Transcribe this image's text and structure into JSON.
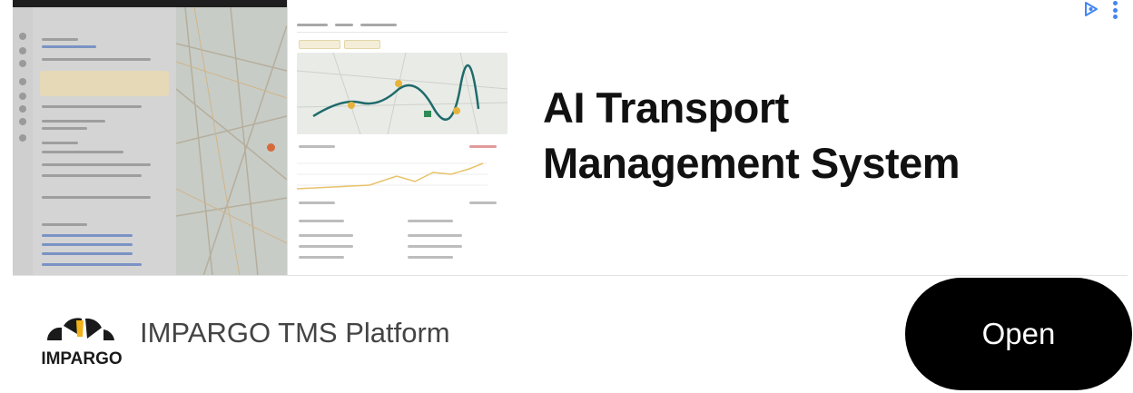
{
  "ad": {
    "headline": [
      "AI Transport",
      "Management System"
    ],
    "advertiser": "IMPARGO TMS Platform",
    "logo_text": "IMPARGO",
    "cta_label": "Open",
    "colors": {
      "cta_background": "#000000",
      "cta_text": "#ffffff",
      "headline": "#111111",
      "adchoices": "#4285f4",
      "logo_dark": "#1a1a1a",
      "logo_accent": "#f2b21b"
    },
    "icons": {
      "adchoices": "adchoices-icon",
      "menu": "kebab-menu-icon"
    }
  }
}
